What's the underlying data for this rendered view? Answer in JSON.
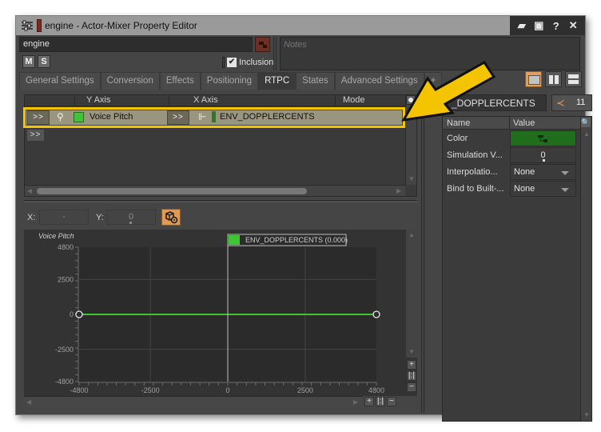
{
  "window": {
    "title": "engine - Actor-Mixer Property Editor",
    "controls": [
      {
        "name": "open-icon",
        "glyph": "▰"
      },
      {
        "name": "save-icon",
        "glyph": "▣"
      },
      {
        "name": "help-icon",
        "glyph": "?"
      },
      {
        "name": "close-icon",
        "glyph": "✕"
      }
    ]
  },
  "object": {
    "name": "engine",
    "mute_label": "M",
    "solo_label": "S",
    "inclusion_label": "Inclusion",
    "inclusion_checked": true,
    "notes_placeholder": "Notes"
  },
  "tabs": [
    {
      "label": "General Settings",
      "active": false
    },
    {
      "label": "Conversion",
      "active": false
    },
    {
      "label": "Effects",
      "active": false
    },
    {
      "label": "Positioning",
      "active": false
    },
    {
      "label": "RTPC",
      "active": true
    },
    {
      "label": "States",
      "active": false
    },
    {
      "label": "Advanced Settings",
      "active": false
    },
    {
      "label": "+",
      "active": false
    }
  ],
  "rtpc_list": {
    "columns": [
      "Y Axis",
      "X Axis",
      "Mode"
    ],
    "rows": [
      {
        "expand_label": ">>",
        "y_axis": "Voice Pitch",
        "y_color": "#3ec532",
        "x_expand_label": ">>",
        "x_axis": "ENV_DOPPLERCENTS",
        "x_color": "#2b7a22",
        "selected": true
      }
    ],
    "new_row_label": ">>"
  },
  "graph_controls": {
    "x_label": "X:",
    "x_value": "-",
    "y_label": "Y:",
    "y_value": "0"
  },
  "chart_data": {
    "type": "line",
    "ylabel": "Voice Pitch",
    "xlabel": "ENV_DOPPLERCENTS",
    "xlim": [
      -4800,
      4800
    ],
    "ylim": [
      -4800,
      4800
    ],
    "x_ticks": [
      "-4800",
      "-2500",
      "0",
      "2500",
      "4800"
    ],
    "y_ticks": [
      "4800",
      "2500",
      "0",
      "-2500",
      "-4800"
    ],
    "grid": true,
    "series": [
      {
        "name": "Voice Pitch",
        "color": "#3ec532",
        "points": [
          [
            -4800,
            0
          ],
          [
            4800,
            0
          ]
        ]
      }
    ],
    "cursor": {
      "x": 0,
      "label": "ENV_DOPPLERCENTS (0.000)"
    }
  },
  "rtpc_panel": {
    "name": "ENV_DOPPLERCENTS",
    "display_name": "_DOPPLERCENTS",
    "references": "11",
    "columns": [
      "Name",
      "Value"
    ],
    "properties": [
      {
        "name": "Color",
        "value": "",
        "kind": "color",
        "color": "#1f6d1d"
      },
      {
        "name": "Simulation V...",
        "value": "0",
        "kind": "number"
      },
      {
        "name": "Interpolatio...",
        "value": "None",
        "kind": "dropdown"
      },
      {
        "name": "Bind to Built-...",
        "value": "None",
        "kind": "dropdown"
      }
    ]
  },
  "colors": {
    "highlight": "#f5c400",
    "accent": "#e09a55"
  }
}
